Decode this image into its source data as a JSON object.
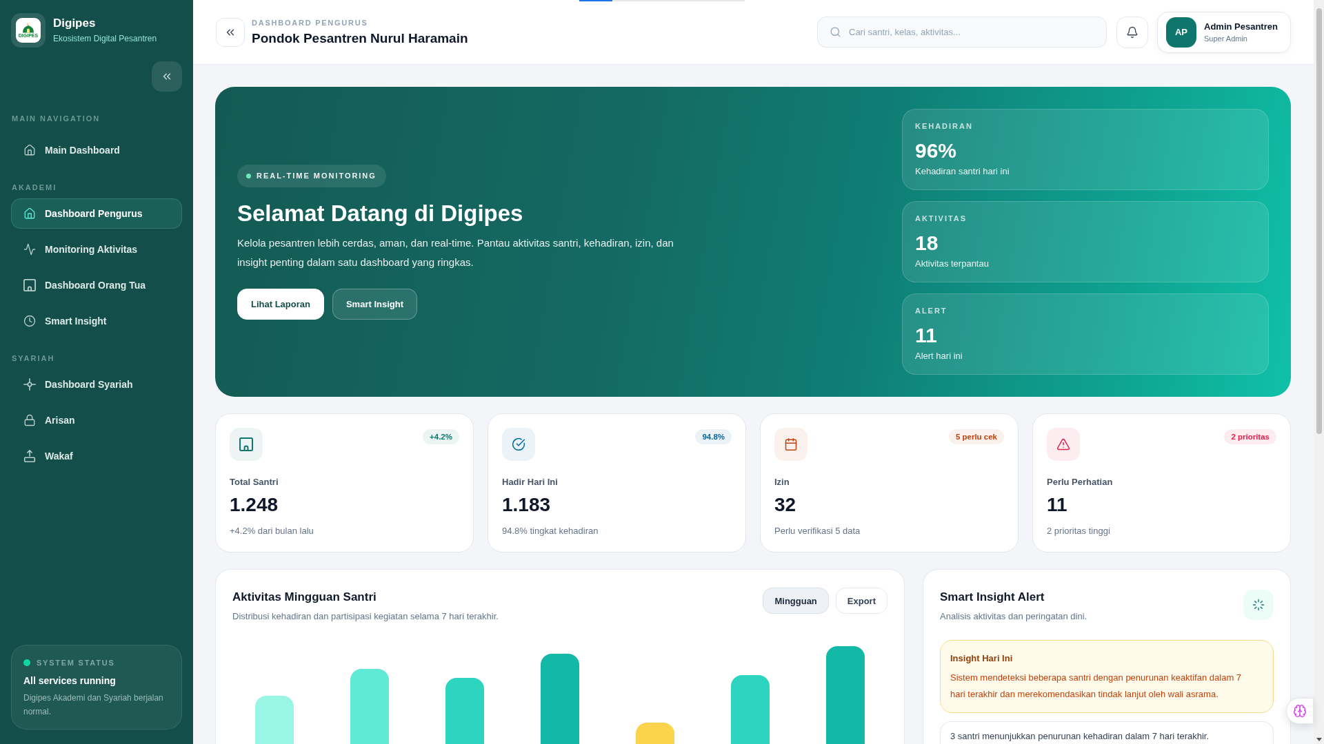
{
  "top_progress": {
    "level": 0.2
  },
  "sidebar": {
    "brand": {
      "logo_text": "DIGIPES",
      "name": "Digipes",
      "tagline": "Ekosistem Digital Pesantren"
    },
    "sections": [
      {
        "title": "MAIN NAVIGATION",
        "items": [
          {
            "label": "Main Dashboard",
            "selected": false
          }
        ]
      },
      {
        "title": "AKADEMI",
        "items": [
          {
            "label": "Dashboard Pengurus",
            "selected": true
          },
          {
            "label": "Monitoring Aktivitas",
            "selected": false
          },
          {
            "label": "Dashboard Orang Tua",
            "selected": false
          },
          {
            "label": "Smart Insight",
            "selected": false
          }
        ]
      },
      {
        "title": "SYARIAH",
        "items": [
          {
            "label": "Dashboard Syariah",
            "selected": false
          },
          {
            "label": "Arisan",
            "selected": false
          },
          {
            "label": "Wakaf",
            "selected": false
          }
        ]
      }
    ],
    "system_status": {
      "title": "SYSTEM STATUS",
      "headline": "All services running",
      "description": "Digipes Akademi dan Syariah berjalan normal."
    }
  },
  "header": {
    "eyebrow": "DASHBOARD PENGURUS",
    "title": "Pondok Pesantren Nurul Haramain",
    "search": {
      "placeholder": "Cari santri, kelas, aktivitas..."
    },
    "user": {
      "initials": "AP",
      "name": "Admin Pesantren",
      "role": "Super Admin"
    }
  },
  "hero": {
    "badge": "REAL-TIME MONITORING",
    "title": "Selamat Datang di Digipes",
    "description": "Kelola pesantren lebih cerdas, aman, dan real-time. Pantau aktivitas santri, kehadiran, izin, dan insight penting dalam satu dashboard yang ringkas.",
    "buttons": [
      {
        "label": "Lihat Laporan",
        "kind": "primary"
      },
      {
        "label": "Smart Insight",
        "kind": "secondary"
      }
    ],
    "stats": [
      {
        "label": "KEHADIRAN",
        "value": "96%",
        "caption": "Kehadiran santri hari ini"
      },
      {
        "label": "AKTIVITAS",
        "value": "18",
        "caption": "Aktivitas terpantau"
      },
      {
        "label": "ALERT",
        "value": "11",
        "caption": "Alert hari ini"
      }
    ]
  },
  "stat_cards": [
    {
      "kind": "students",
      "color": "#0f766e",
      "badge": "+4.2%",
      "label": "Total Santri",
      "value": "1.248",
      "note": "+4.2% dari bulan lalu"
    },
    {
      "kind": "attendance",
      "color": "#0369a1",
      "badge": "94.8%",
      "label": "Hadir Hari Ini",
      "value": "1.183",
      "note": "94.8% tingkat kehadiran"
    },
    {
      "kind": "permission",
      "color": "#c2410c",
      "badge": "5 perlu cek",
      "label": "Izin",
      "value": "32",
      "note": "Perlu verifikasi 5 data"
    },
    {
      "kind": "alert",
      "color": "#e11d48",
      "badge": "2 prioritas",
      "label": "Perlu Perhatian",
      "value": "11",
      "note": "2 prioritas tinggi"
    }
  ],
  "weekly_activity": {
    "title": "Aktivitas Mingguan Santri",
    "subtitle": "Distribusi kehadiran dan partisipasi kegiatan selama 7 hari terakhir.",
    "buttons": [
      {
        "label": "Mingguan",
        "selected": true
      },
      {
        "label": "Export",
        "selected": false
      }
    ]
  },
  "insight_panel": {
    "title": "Smart Insight Alert",
    "subtitle": "Analisis aktivitas dan peringatan dini.",
    "highlight": {
      "title": "Insight Hari Ini",
      "text": "Sistem mendeteksi beberapa santri dengan penurunan keaktifan dalam 7 hari terakhir dan merekomendasikan tindak lanjut oleh wali asrama."
    },
    "items": [
      "3 santri menunjukkan penurunan kehadiran dalam 7 hari terakhir."
    ]
  }
}
